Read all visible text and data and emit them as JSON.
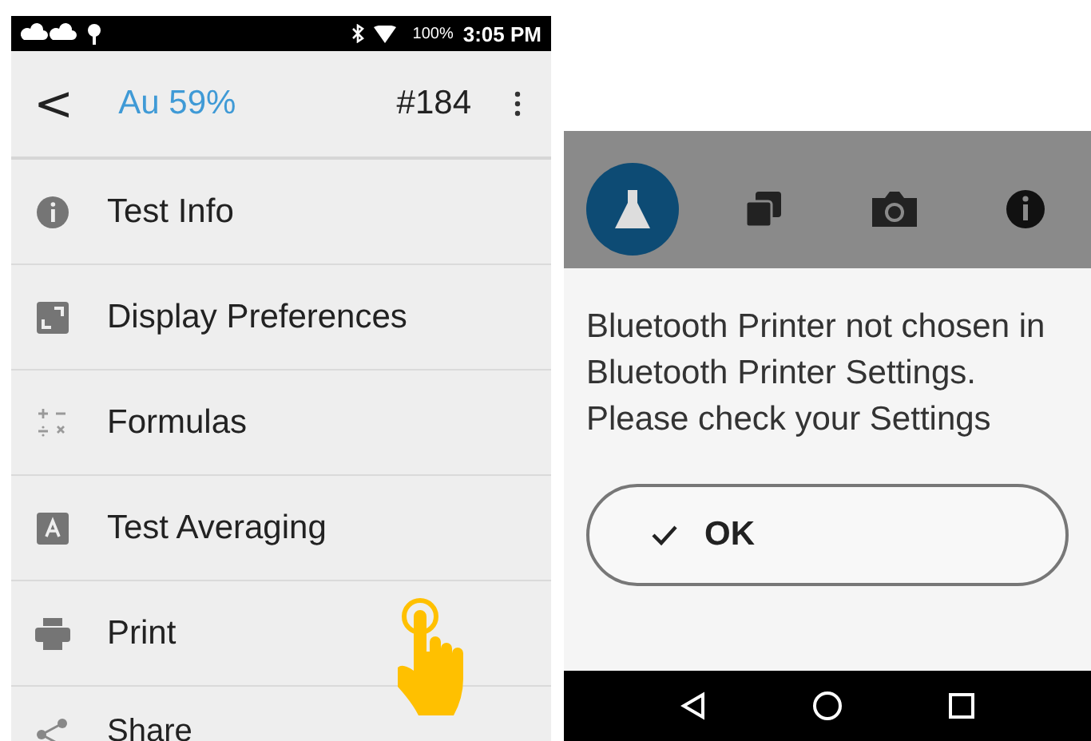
{
  "left_screen": {
    "status_bar": {
      "battery": "100%",
      "time": "3:05 PM"
    },
    "app_bar": {
      "back": "<",
      "title": "Au 59%",
      "number": "#184"
    },
    "menu": [
      {
        "kind": "info",
        "label": "Test Info"
      },
      {
        "kind": "display",
        "label": "Display Preferences"
      },
      {
        "kind": "formulas",
        "label": "Formulas"
      },
      {
        "kind": "averaging",
        "label": "Test Averaging"
      },
      {
        "kind": "print",
        "label": "Print"
      },
      {
        "kind": "share",
        "label": "Share"
      }
    ]
  },
  "right_screen": {
    "tabs": [
      {
        "kind": "flask",
        "selected": true
      },
      {
        "kind": "copy",
        "selected": false
      },
      {
        "kind": "camera",
        "selected": false
      },
      {
        "kind": "info",
        "selected": false
      }
    ],
    "dialog": {
      "message": "Bluetooth Printer not chosen in Bluetooth Printer Settings. Please check your Settings",
      "button": "OK"
    }
  }
}
